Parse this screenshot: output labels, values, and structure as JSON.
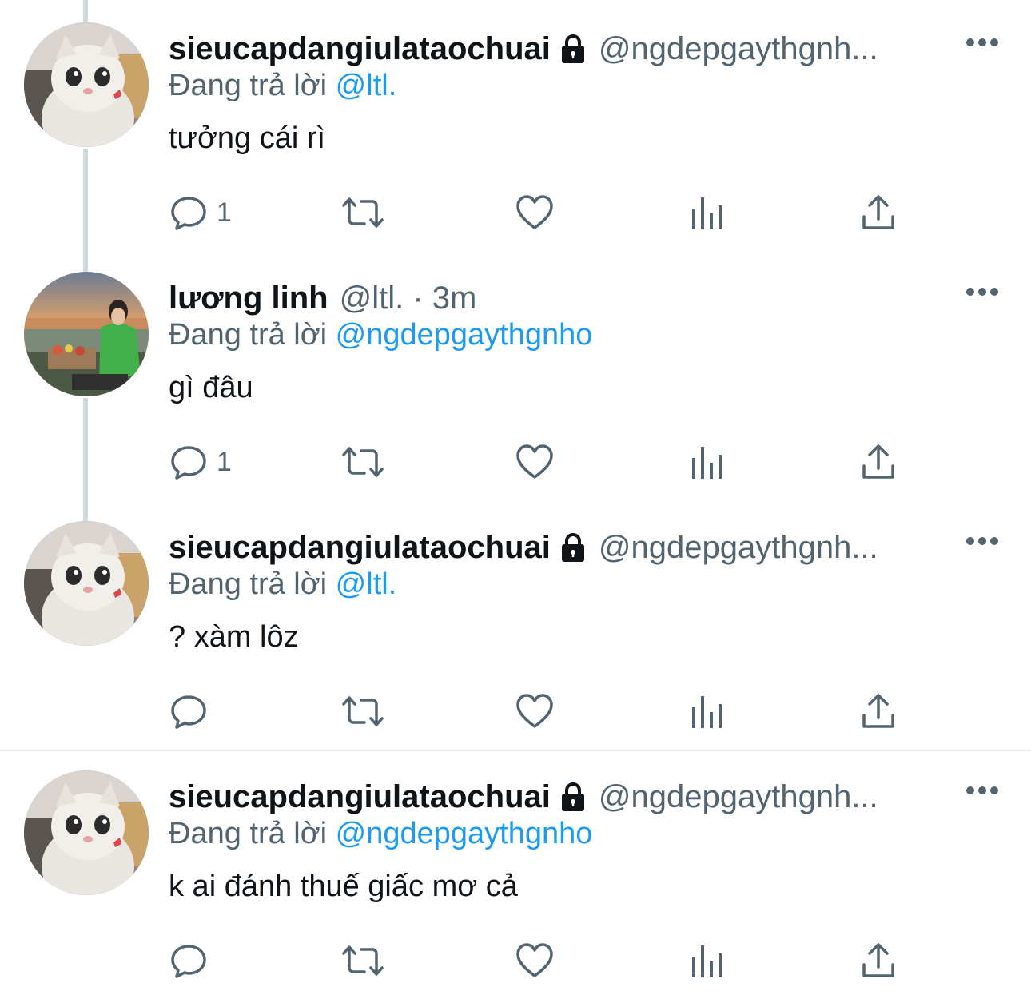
{
  "colors": {
    "accent": "#1d9bf0",
    "muted": "#536471",
    "text": "#0f1419",
    "thread_line": "#cfd9de"
  },
  "tweets": [
    {
      "display_name": "sieucapdangiulataochuai",
      "handle": "@ngdepgaythgnh...",
      "time": "",
      "reply_prefix": "Đang trả lời",
      "reply_to": "@ltl.",
      "text": "tưởng cái rì",
      "reply_count": "1",
      "avatar": "cat-avatar",
      "locked": true
    },
    {
      "display_name": "lương linh",
      "handle": "@ltl. · 3m",
      "time": "3m",
      "reply_prefix": "Đang trả lời",
      "reply_to": "@ngdepgaythgnho",
      "text": "gì đâu",
      "reply_count": "1",
      "avatar": "beach-photo-avatar",
      "locked": false
    },
    {
      "display_name": "sieucapdangiulataochuai",
      "handle": "@ngdepgaythgnh...",
      "time": "",
      "reply_prefix": "Đang trả lời",
      "reply_to": "@ltl.",
      "text": "? xàm lôz",
      "reply_count": "",
      "avatar": "cat-avatar",
      "locked": true
    },
    {
      "display_name": "sieucapdangiulataochuai",
      "handle": "@ngdepgaythgnh...",
      "time": "",
      "reply_prefix": "Đang trả lời",
      "reply_to": "@ngdepgaythgnho",
      "text": "k ai đánh thuế giấc mơ cả",
      "reply_count": "",
      "avatar": "cat-avatar",
      "locked": true
    }
  ],
  "icons": {
    "reply": "reply-bubble-icon",
    "retweet": "retweet-icon",
    "like": "heart-icon",
    "views": "views-bar-chart-icon",
    "share": "share-upload-icon",
    "more": "more-dots-icon",
    "lock": "lock-icon"
  }
}
